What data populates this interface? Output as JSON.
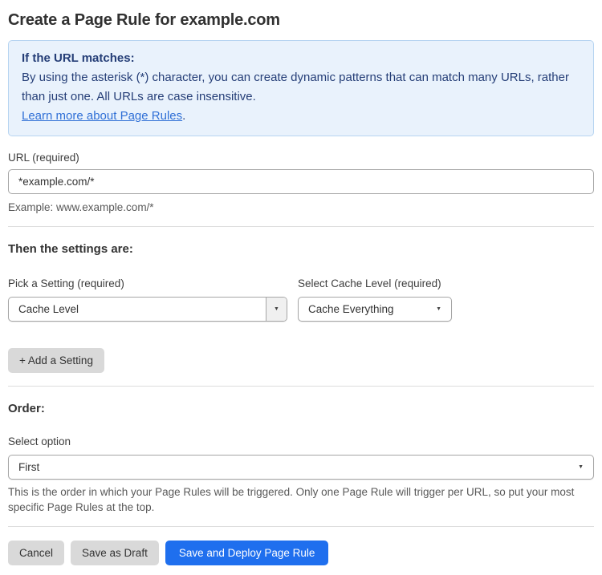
{
  "page": {
    "title": "Create a Page Rule for example.com"
  },
  "info_box": {
    "heading": "If the URL matches:",
    "body": "By using the asterisk (*) character, you can create dynamic patterns that can match many URLs, rather than just one. All URLs are case insensitive.",
    "link_label": "Learn more about Page Rules",
    "link_suffix": "."
  },
  "url_field": {
    "label": "URL (required)",
    "value": "*example.com/*",
    "helper": "Example: www.example.com/*"
  },
  "settings_section": {
    "heading": "Then the settings are:",
    "setting_picker": {
      "label": "Pick a Setting (required)",
      "value": "Cache Level"
    },
    "cache_level": {
      "label": "Select Cache Level (required)",
      "value": "Cache Everything"
    },
    "add_setting_label": "+ Add a Setting"
  },
  "order_section": {
    "heading": "Order:",
    "select_label": "Select option",
    "value": "First",
    "helper": "This is the order in which your Page Rules will be triggered. Only one Page Rule will trigger per URL, so put your most specific Page Rules at the top."
  },
  "actions": {
    "cancel": "Cancel",
    "save_draft": "Save as Draft",
    "save_deploy": "Save and Deploy Page Rule"
  },
  "icons": {
    "dropdown_arrow": "▼"
  },
  "colors": {
    "accent_blue": "#1f6fee",
    "info_bg": "#e9f2fc",
    "info_border": "#b7d4f1",
    "info_text": "#253e77",
    "link_blue": "#2f6fd6",
    "button_gray": "#d9d9d9"
  }
}
